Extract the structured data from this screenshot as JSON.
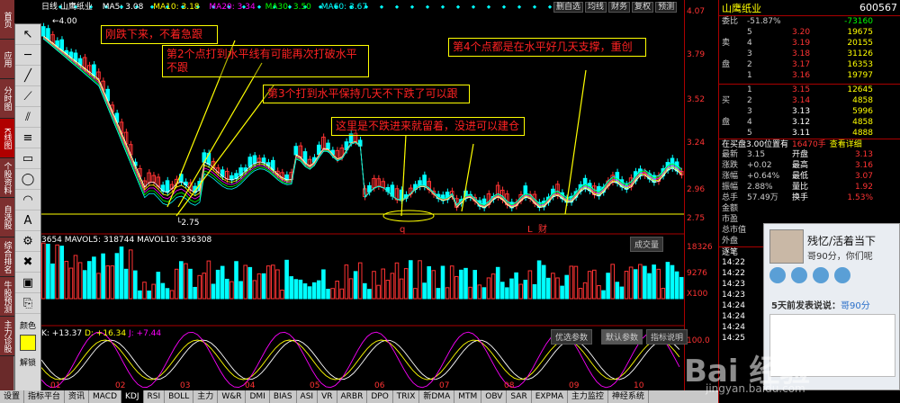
{
  "left_tabs": [
    "首页",
    "应用",
    "分时图",
    "K线图",
    "个股资料",
    "自选股",
    "综合排名",
    "牛股预测",
    "主力诊股"
  ],
  "left_tabs_active": 3,
  "toolbar": {
    "color_label": "颜色",
    "unlock_label": "解锁"
  },
  "top_info": {
    "stock_prefix": "日线 山鹰纸业",
    "ma5": "MA5: 3.08",
    "ma10": "MA10: 3.18",
    "ma20": "MA20: 3.34",
    "ma30": "MA30: 3.50",
    "ma60": "MA60: 3.67"
  },
  "chart_buttons": [
    "删自选",
    "均线",
    "财务",
    "复权",
    "预测"
  ],
  "price_axis": [
    "4.07",
    "3.79",
    "3.52",
    "3.24",
    "2.96",
    "2.75"
  ],
  "price_markers": {
    "high": "4.00",
    "low": "2.75"
  },
  "volume": {
    "label1": "3654",
    "mavol5": "MAVOL5: 318744",
    "mavol10": "MAVOL10: 336308",
    "axis_top": "18326",
    "axis_mid": "9276",
    "axis_unit": "X100",
    "btn": "成交量"
  },
  "kdj": {
    "k": "K: +13.37",
    "d": "D: +16.34",
    "j": "J: +7.44",
    "axis_top": "100.0",
    "btn1": "优选参数",
    "btn2": "默认参数",
    "btn3": "指标说明"
  },
  "dates": [
    "01",
    "02",
    "03",
    "04",
    "05",
    "06",
    "07",
    "08",
    "09",
    "10"
  ],
  "annotations": [
    "刚跌下来，不着急跟",
    "第2个点打到水平线有可能再次打破水平不跟",
    "第3个打到水平保持几天不下跌了可以跟",
    "这里是不跌进来就留着，没进可以建仓",
    "第4个点都是在水平好几天支撑，重创"
  ],
  "chart_letters": [
    "q",
    "L",
    "财"
  ],
  "bottom_tabs": [
    "设置",
    "指标平台",
    "资讯",
    "MACD",
    "KDJ",
    "RSI",
    "BOLL",
    "主力",
    "W&R",
    "DMI",
    "BIAS",
    "ASI",
    "VR",
    "ARBR",
    "DPO",
    "TRIX",
    "新DMA",
    "MTM",
    "OBV",
    "SAR",
    "EXPMA",
    "主力监控",
    "神经系统"
  ],
  "bottom_tabs_active": 4,
  "quote": {
    "title": "山鹰纸业",
    "code": "600567",
    "weibi_label": "委比",
    "weibi_val": "-51.87%",
    "weicha_val": "-73160",
    "sells": [
      {
        "lvl": "5",
        "price": "3.20",
        "vol": "19675"
      },
      {
        "lvl": "4",
        "price": "3.19",
        "vol": "20155"
      },
      {
        "lvl": "3",
        "price": "3.18",
        "vol": "31126"
      },
      {
        "lvl": "2",
        "price": "3.17",
        "vol": "16353"
      },
      {
        "lvl": "1",
        "price": "3.16",
        "vol": "19797"
      }
    ],
    "sell_label": "卖盘",
    "buys": [
      {
        "lvl": "1",
        "price": "3.15",
        "vol": "12645"
      },
      {
        "lvl": "2",
        "price": "3.14",
        "vol": "4858"
      },
      {
        "lvl": "3",
        "price": "3.13",
        "vol": "5996"
      },
      {
        "lvl": "4",
        "price": "3.12",
        "vol": "4858"
      },
      {
        "lvl": "5",
        "price": "3.11",
        "vol": "4888"
      }
    ],
    "buy_label": "买盘",
    "buy_extra": "+33",
    "in_buy": "在买盘3.00位置有",
    "in_buy2": "16470手",
    "detail": "查看详细",
    "stats": [
      {
        "l": "最新",
        "v": "3.15",
        "l2": "开盘",
        "v2": "3.13"
      },
      {
        "l": "涨跌",
        "v": "+0.02",
        "l2": "最高",
        "v2": "3.16"
      },
      {
        "l": "涨幅",
        "v": "+0.64%",
        "l2": "最低",
        "v2": "3.07"
      },
      {
        "l": "振幅",
        "v": "2.88%",
        "l2": "量比",
        "v2": "1.92"
      },
      {
        "l": "总手",
        "v": "57.49万",
        "l2": "换手",
        "v2": "1.53%"
      },
      {
        "l": "金额",
        "v": "",
        "l2": "",
        "v2": ""
      },
      {
        "l": "市盈",
        "v": "",
        "l2": "",
        "v2": ""
      },
      {
        "l": "总市值",
        "v": "",
        "l2": "",
        "v2": ""
      },
      {
        "l": "外盘",
        "v": "",
        "l2": "",
        "v2": ""
      }
    ],
    "trades_label": "逐笔",
    "times": [
      "14:22",
      "14:22",
      "14:23",
      "14:23",
      "14:24",
      "14:24",
      "14:24",
      "14:25"
    ]
  },
  "qq_popup": {
    "name": "残忆/活着当下",
    "sub": "哥90分，你们呢",
    "post_prefix": "5天前发表说说：",
    "post_link": "哥90分"
  },
  "watermark": "Bai 经验",
  "watermark_url": "jingyan.baidu.com"
}
